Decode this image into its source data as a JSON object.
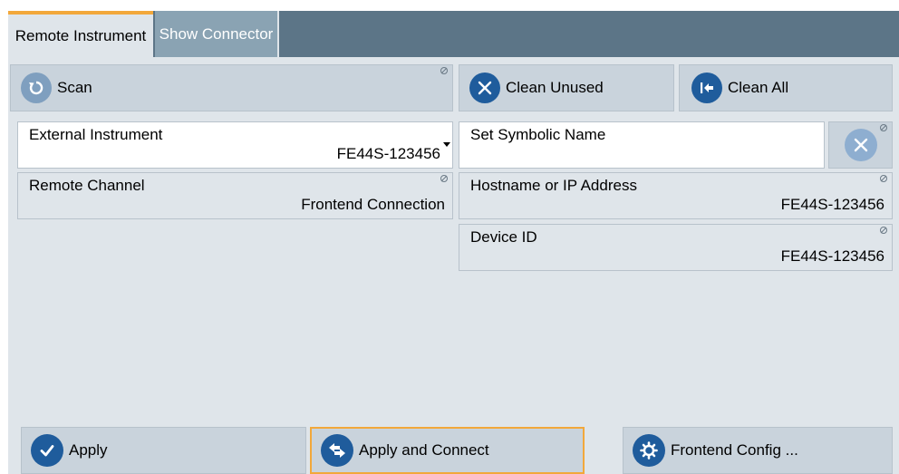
{
  "tabs": [
    {
      "label": "Remote Instrument"
    },
    {
      "label": "Show Connector"
    }
  ],
  "toolbar": {
    "scan_label": "Scan",
    "clean_unused_label": "Clean Unused",
    "clean_all_label": "Clean All"
  },
  "fields": {
    "external_instrument": {
      "label": "External Instrument",
      "value": "FE44S-123456"
    },
    "symbolic_name": {
      "label": "Set Symbolic Name",
      "value": ""
    },
    "remote_channel": {
      "label": "Remote Channel",
      "value": "Frontend Connection"
    },
    "hostname": {
      "label": "Hostname or IP Address",
      "value": "FE44S-123456"
    },
    "device_id": {
      "label": "Device ID",
      "value": "FE44S-123456"
    }
  },
  "actions": {
    "apply_label": "Apply",
    "apply_connect_label": "Apply and Connect",
    "frontend_config_label": "Frontend Config ..."
  },
  "colors": {
    "tab_bar": "#5c7587",
    "panel_bg": "#dfe5ea",
    "button_bg": "#c9d3dc",
    "accent_orange": "#f2a83b",
    "icon_blue": "#1f5c9c",
    "icon_light_blue": "#7f9fbf"
  }
}
